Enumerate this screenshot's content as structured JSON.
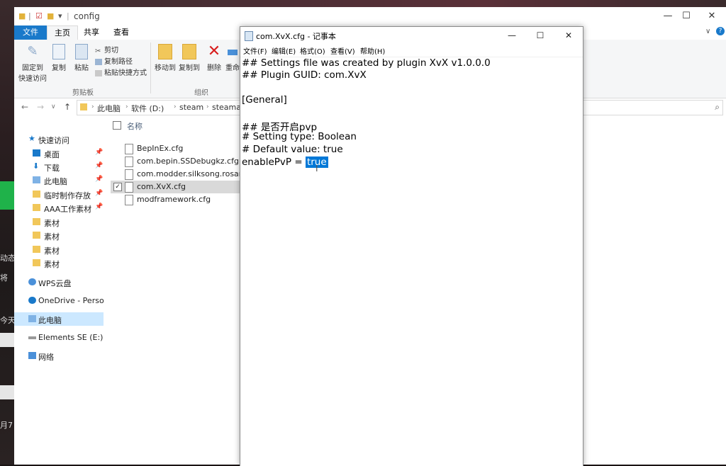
{
  "explorer": {
    "title": "config",
    "tabs": [
      "文件",
      "主页",
      "共享",
      "查看"
    ],
    "ribbon": {
      "pin_label": "固定到快速访问",
      "pin_label_line1": "固定到",
      "pin_label_line2": "快速访问",
      "copy_label": "复制",
      "paste_label": "粘贴",
      "cut_label": "剪切",
      "copy_path_label": "复制路径",
      "paste_shortcut_label": "粘贴快捷方式",
      "clipboard_group": "剪贴板",
      "move_to_label": "移动到",
      "copy_to_label": "复制到",
      "delete_label": "删除",
      "rename_label": "重命",
      "organize_group": "组织"
    },
    "breadcrumb": [
      "此电脑",
      "软件 (D:)",
      "steam",
      "steamapps"
    ],
    "nav": {
      "quick_access": "快速访问",
      "items": [
        {
          "label": "桌面",
          "pinned": true
        },
        {
          "label": "下载",
          "pinned": true
        },
        {
          "label": "此电脑",
          "pinned": true
        },
        {
          "label": "临时制作存放",
          "pinned": true
        },
        {
          "label": "AAA工作素材",
          "pinned": true
        },
        {
          "label": "素材",
          "pinned": false
        },
        {
          "label": "素材",
          "pinned": false
        },
        {
          "label": "素材",
          "pinned": false
        },
        {
          "label": "素材",
          "pinned": false
        }
      ],
      "wps": "WPS云盘",
      "onedrive": "OneDrive - Persona",
      "this_pc": "此电脑",
      "elements": "Elements SE (E:)",
      "network": "网络"
    },
    "files": {
      "column_name": "名称",
      "items": [
        "BepInEx.cfg",
        "com.bepin.SSDebugkz.cfg",
        "com.modder.silksong.rosarymo",
        "com.XvX.cfg",
        "modframework.cfg"
      ]
    }
  },
  "notepad": {
    "title": "com.XvX.cfg - 记事本",
    "menu": [
      "文件(F)",
      "编辑(E)",
      "格式(O)",
      "查看(V)",
      "帮助(H)"
    ],
    "lines": [
      "## Settings file was created by plugin XvX v1.0.0.0",
      "## Plugin GUID: com.XvX",
      "",
      "[General]",
      "",
      "## 是否开启pvp",
      "# Setting type: Boolean",
      "# Default value: true"
    ],
    "last_line_prefix": "enablePvP = ",
    "last_line_selected": "true"
  },
  "background": {
    "side_texts": [
      "动态",
      "将",
      "今天",
      "月7"
    ]
  },
  "colors": {
    "accent": "#0078d7",
    "file_tab": "#1979ca",
    "selection": "#cce8ff"
  }
}
